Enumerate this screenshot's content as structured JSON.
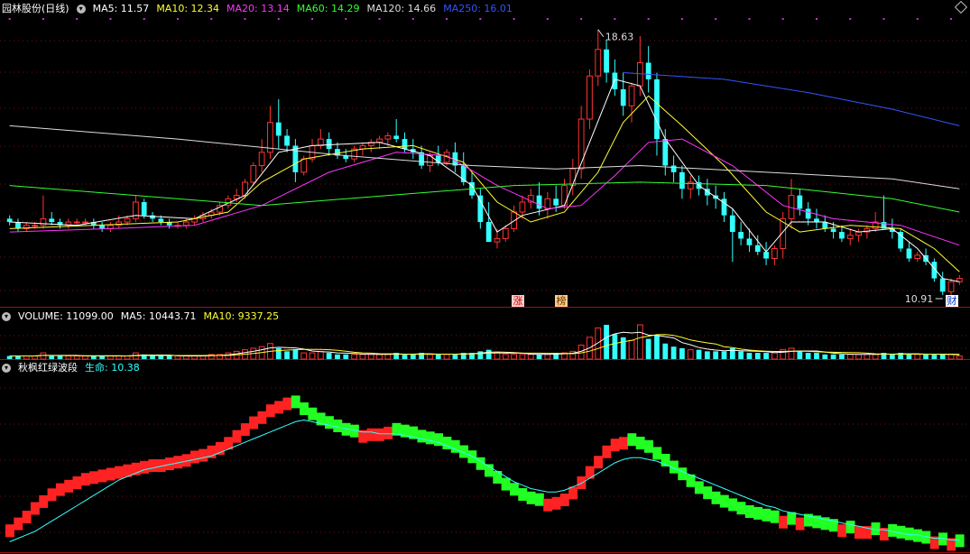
{
  "main_panel": {
    "stock_name": "园林股份(日线)",
    "ma_items": [
      {
        "label": "MA5: 11.57",
        "color": "#ffffff"
      },
      {
        "label": "MA10: 12.34",
        "color": "#ffff33"
      },
      {
        "label": "MA20: 13.14",
        "color": "#ff33ff"
      },
      {
        "label": "MA60: 14.29",
        "color": "#33ff33"
      },
      {
        "label": "MA120: 14.66",
        "color": "#dddddd"
      },
      {
        "label": "MA250: 16.01",
        "color": "#3355ff"
      }
    ],
    "high_label": "18.63",
    "low_label": "10.91",
    "tag_limit": "涨",
    "tag_rank": "榜",
    "tag_finance": "财"
  },
  "volume_panel": {
    "items": [
      {
        "label": "VOLUME: 11099.00",
        "color": "#ffffff"
      },
      {
        "label": "MA5: 10443.71",
        "color": "#ffffff"
      },
      {
        "label": "MA10: 9337.25",
        "color": "#ffff33"
      }
    ]
  },
  "indicator_panel": {
    "name": "秋枫红绿波段",
    "life_label": "生命: 10.38",
    "name_color": "#ffffff",
    "life_color": "#33ffff"
  },
  "chart_data": {
    "type": "candlestick",
    "price_range": [
      10.6,
      19.3
    ],
    "up_color": "#ff3333",
    "down_color": "#33ffff",
    "candles": [
      [
        13.2,
        13.3,
        13.0,
        13.1
      ],
      [
        13.1,
        13.2,
        12.8,
        12.9
      ],
      [
        12.9,
        13.1,
        12.8,
        13.0
      ],
      [
        13.0,
        13.1,
        12.9,
        13.0
      ],
      [
        13.0,
        13.9,
        12.9,
        13.2
      ],
      [
        13.2,
        13.4,
        13.0,
        13.1
      ],
      [
        13.1,
        13.2,
        12.9,
        13.0
      ],
      [
        13.0,
        13.2,
        12.9,
        13.1
      ],
      [
        13.1,
        13.2,
        13.0,
        13.1
      ],
      [
        13.1,
        13.2,
        13.0,
        13.1
      ],
      [
        13.1,
        13.2,
        12.9,
        13.0
      ],
      [
        13.0,
        13.1,
        12.8,
        12.9
      ],
      [
        12.9,
        13.1,
        12.8,
        13.0
      ],
      [
        13.0,
        13.3,
        12.9,
        13.1
      ],
      [
        13.1,
        13.3,
        13.0,
        13.2
      ],
      [
        13.2,
        13.9,
        13.1,
        13.7
      ],
      [
        13.7,
        13.8,
        13.2,
        13.3
      ],
      [
        13.3,
        13.4,
        13.1,
        13.2
      ],
      [
        13.2,
        13.3,
        13.0,
        13.1
      ],
      [
        13.1,
        13.2,
        12.9,
        13.0
      ],
      [
        13.0,
        13.1,
        12.9,
        13.0
      ],
      [
        13.0,
        13.2,
        12.9,
        13.1
      ],
      [
        13.1,
        13.3,
        13.0,
        13.2
      ],
      [
        13.2,
        13.4,
        13.1,
        13.3
      ],
      [
        13.3,
        13.5,
        13.2,
        13.4
      ],
      [
        13.4,
        13.7,
        13.3,
        13.6
      ],
      [
        13.6,
        13.9,
        13.5,
        13.8
      ],
      [
        13.8,
        14.1,
        13.7,
        13.9
      ],
      [
        13.9,
        14.4,
        13.8,
        14.3
      ],
      [
        14.3,
        14.9,
        14.2,
        14.8
      ],
      [
        14.8,
        15.6,
        14.6,
        15.2
      ],
      [
        15.2,
        16.6,
        15.0,
        16.1
      ],
      [
        16.1,
        16.8,
        15.3,
        15.7
      ],
      [
        15.7,
        15.9,
        15.2,
        15.4
      ],
      [
        15.4,
        15.6,
        14.3,
        14.6
      ],
      [
        14.6,
        15.1,
        14.5,
        15.0
      ],
      [
        15.0,
        15.6,
        14.9,
        15.4
      ],
      [
        15.4,
        15.9,
        15.3,
        15.6
      ],
      [
        15.6,
        15.8,
        15.1,
        15.3
      ],
      [
        15.3,
        15.5,
        15.0,
        15.1
      ],
      [
        15.1,
        15.3,
        14.9,
        15.0
      ],
      [
        15.0,
        15.4,
        14.9,
        15.3
      ],
      [
        15.3,
        15.5,
        15.1,
        15.4
      ],
      [
        15.4,
        15.6,
        15.2,
        15.5
      ],
      [
        15.5,
        15.7,
        15.3,
        15.6
      ],
      [
        15.6,
        15.8,
        15.4,
        15.7
      ],
      [
        15.7,
        16.2,
        15.5,
        15.6
      ],
      [
        15.6,
        15.8,
        15.2,
        15.3
      ],
      [
        15.3,
        15.6,
        15.0,
        15.2
      ],
      [
        15.2,
        15.4,
        14.7,
        14.8
      ],
      [
        14.8,
        15.2,
        14.6,
        15.1
      ],
      [
        15.1,
        15.4,
        14.8,
        14.9
      ],
      [
        14.9,
        15.3,
        14.8,
        15.2
      ],
      [
        15.2,
        15.5,
        14.6,
        14.8
      ],
      [
        14.8,
        15.2,
        14.2,
        14.3
      ],
      [
        14.3,
        14.6,
        13.8,
        13.9
      ],
      [
        13.9,
        14.1,
        12.9,
        13.1
      ],
      [
        13.1,
        13.7,
        12.7,
        12.5
      ],
      [
        12.5,
        12.9,
        12.3,
        12.6
      ],
      [
        12.6,
        13.0,
        12.5,
        12.9
      ],
      [
        12.9,
        13.6,
        12.8,
        13.4
      ],
      [
        13.4,
        13.9,
        13.2,
        13.7
      ],
      [
        13.7,
        14.1,
        13.5,
        13.9
      ],
      [
        13.9,
        14.3,
        13.3,
        13.5
      ],
      [
        13.5,
        14.0,
        13.2,
        13.8
      ],
      [
        13.8,
        14.2,
        13.4,
        13.6
      ],
      [
        13.6,
        14.4,
        13.5,
        14.2
      ],
      [
        14.2,
        15.0,
        13.9,
        14.7
      ],
      [
        14.7,
        16.6,
        14.4,
        16.2
      ],
      [
        16.2,
        17.7,
        15.9,
        17.5
      ],
      [
        17.5,
        18.9,
        17.2,
        18.3
      ],
      [
        18.3,
        18.6,
        17.3,
        17.6
      ],
      [
        17.6,
        18.0,
        16.9,
        17.1
      ],
      [
        17.1,
        17.6,
        16.3,
        16.6
      ],
      [
        16.6,
        17.3,
        16.1,
        17.2
      ],
      [
        17.2,
        18.7,
        16.9,
        17.9
      ],
      [
        17.9,
        18.4,
        17.0,
        17.4
      ],
      [
        17.4,
        17.6,
        15.1,
        15.6
      ],
      [
        15.6,
        15.9,
        14.5,
        14.8
      ],
      [
        14.8,
        15.1,
        14.3,
        14.6
      ],
      [
        14.6,
        14.8,
        13.8,
        14.1
      ],
      [
        14.1,
        14.5,
        13.8,
        14.3
      ],
      [
        14.3,
        14.5,
        13.9,
        14.1
      ],
      [
        14.1,
        14.4,
        13.6,
        13.9
      ],
      [
        13.9,
        14.2,
        13.5,
        13.8
      ],
      [
        13.8,
        14.0,
        13.1,
        13.3
      ],
      [
        13.3,
        13.5,
        11.9,
        12.8
      ],
      [
        12.8,
        13.1,
        12.4,
        12.6
      ],
      [
        12.6,
        12.9,
        12.2,
        12.4
      ],
      [
        12.4,
        12.7,
        12.1,
        12.2
      ],
      [
        12.2,
        12.5,
        11.8,
        12.0
      ],
      [
        12.0,
        12.4,
        11.8,
        12.3
      ],
      [
        12.3,
        13.4,
        12.0,
        13.2
      ],
      [
        13.2,
        14.4,
        12.9,
        13.9
      ],
      [
        13.9,
        14.1,
        13.3,
        13.5
      ],
      [
        13.5,
        13.7,
        13.0,
        13.2
      ],
      [
        13.2,
        13.5,
        12.9,
        13.1
      ],
      [
        13.1,
        13.3,
        12.8,
        12.9
      ],
      [
        12.9,
        13.1,
        12.6,
        12.8
      ],
      [
        12.8,
        13.0,
        12.5,
        12.6
      ],
      [
        12.6,
        12.9,
        12.4,
        12.7
      ],
      [
        12.7,
        12.9,
        12.5,
        12.8
      ],
      [
        12.8,
        13.0,
        12.6,
        12.9
      ],
      [
        12.9,
        13.4,
        12.8,
        13.1
      ],
      [
        13.1,
        13.9,
        13.0,
        12.9
      ],
      [
        12.9,
        13.2,
        12.6,
        12.8
      ],
      [
        12.8,
        12.9,
        12.2,
        12.3
      ],
      [
        12.3,
        12.5,
        11.9,
        12.0
      ],
      [
        12.0,
        12.2,
        11.9,
        12.1
      ],
      [
        12.1,
        12.3,
        11.8,
        11.9
      ],
      [
        11.9,
        12.0,
        11.3,
        11.4
      ],
      [
        11.4,
        11.6,
        10.9,
        11.0
      ],
      [
        11.0,
        11.4,
        10.9,
        11.3
      ],
      [
        11.3,
        11.5,
        11.2,
        11.4
      ]
    ],
    "ma_series": [
      {
        "name": "MA5",
        "color": "#ffffff",
        "points": [
          [
            0,
            13.1
          ],
          [
            8,
            13.0
          ],
          [
            15,
            13.3
          ],
          [
            22,
            13.2
          ],
          [
            28,
            13.9
          ],
          [
            32,
            15.2
          ],
          [
            36,
            15.4
          ],
          [
            44,
            15.5
          ],
          [
            50,
            15.1
          ],
          [
            55,
            14.2
          ],
          [
            58,
            12.8
          ],
          [
            61,
            13.3
          ],
          [
            66,
            13.6
          ],
          [
            69,
            15.5
          ],
          [
            72,
            17.4
          ],
          [
            75,
            17.2
          ],
          [
            78,
            15.6
          ],
          [
            82,
            14.2
          ],
          [
            86,
            13.5
          ],
          [
            90,
            12.2
          ],
          [
            93,
            13.1
          ],
          [
            97,
            13.1
          ],
          [
            101,
            12.8
          ],
          [
            105,
            12.9
          ],
          [
            108,
            12.3
          ],
          [
            111,
            11.4
          ],
          [
            113,
            11.3
          ]
        ]
      },
      {
        "name": "MA10",
        "color": "#ffff33",
        "points": [
          [
            0,
            12.9
          ],
          [
            10,
            13.0
          ],
          [
            20,
            13.1
          ],
          [
            26,
            13.4
          ],
          [
            30,
            14.3
          ],
          [
            35,
            15.0
          ],
          [
            42,
            15.3
          ],
          [
            48,
            15.4
          ],
          [
            54,
            14.9
          ],
          [
            58,
            13.7
          ],
          [
            62,
            13.1
          ],
          [
            66,
            13.4
          ],
          [
            70,
            14.6
          ],
          [
            73,
            16.1
          ],
          [
            76,
            16.9
          ],
          [
            80,
            16.0
          ],
          [
            85,
            14.8
          ],
          [
            90,
            13.4
          ],
          [
            94,
            12.8
          ],
          [
            100,
            13.0
          ],
          [
            106,
            12.9
          ],
          [
            110,
            12.3
          ],
          [
            113,
            11.6
          ]
        ]
      },
      {
        "name": "MA20",
        "color": "#ff33ff",
        "points": [
          [
            0,
            12.8
          ],
          [
            12,
            12.9
          ],
          [
            22,
            13.0
          ],
          [
            30,
            13.6
          ],
          [
            38,
            14.6
          ],
          [
            46,
            15.2
          ],
          [
            52,
            15.1
          ],
          [
            58,
            14.2
          ],
          [
            64,
            13.5
          ],
          [
            68,
            13.6
          ],
          [
            72,
            14.5
          ],
          [
            76,
            15.5
          ],
          [
            80,
            15.6
          ],
          [
            86,
            14.8
          ],
          [
            92,
            13.6
          ],
          [
            98,
            13.2
          ],
          [
            106,
            13.0
          ],
          [
            113,
            12.4
          ]
        ]
      },
      {
        "name": "MA60",
        "color": "#33ff33",
        "points": [
          [
            0,
            14.2
          ],
          [
            15,
            13.9
          ],
          [
            30,
            13.6
          ],
          [
            45,
            13.9
          ],
          [
            60,
            14.2
          ],
          [
            75,
            14.3
          ],
          [
            90,
            14.2
          ],
          [
            105,
            13.8
          ],
          [
            113,
            13.4
          ]
        ]
      },
      {
        "name": "MA120",
        "color": "#dddddd",
        "points": [
          [
            0,
            16.0
          ],
          [
            20,
            15.6
          ],
          [
            40,
            15.1
          ],
          [
            55,
            14.8
          ],
          [
            65,
            14.7
          ],
          [
            75,
            14.8
          ],
          [
            90,
            14.6
          ],
          [
            105,
            14.4
          ],
          [
            113,
            14.1
          ]
        ]
      },
      {
        "name": "MA250",
        "color": "#3355ff",
        "points": [
          [
            73,
            17.6
          ],
          [
            85,
            17.4
          ],
          [
            95,
            17.0
          ],
          [
            105,
            16.5
          ],
          [
            113,
            16.0
          ]
        ]
      }
    ],
    "volume": [
      2,
      2,
      2,
      2,
      4,
      2,
      2,
      2,
      2,
      2,
      2,
      2,
      2,
      2,
      2,
      4,
      3,
      2,
      2,
      2,
      2,
      2,
      2,
      2,
      3,
      3,
      4,
      5,
      6,
      7,
      8,
      10,
      7,
      5,
      6,
      4,
      4,
      5,
      4,
      3,
      3,
      3,
      3,
      3,
      3,
      3,
      4,
      3,
      3,
      4,
      3,
      3,
      3,
      3,
      4,
      4,
      5,
      6,
      4,
      3,
      3,
      3,
      3,
      3,
      3,
      4,
      4,
      5,
      9,
      14,
      20,
      22,
      16,
      14,
      12,
      22,
      13,
      15,
      10,
      8,
      7,
      6,
      6,
      5,
      5,
      5,
      7,
      5,
      4,
      4,
      4,
      4,
      6,
      7,
      5,
      4,
      4,
      3,
      3,
      3,
      3,
      3,
      3,
      3,
      4,
      3,
      4,
      3,
      3,
      3,
      3,
      3,
      3,
      2
    ],
    "indicator": {
      "range": [
        0,
        100
      ],
      "wave": [
        12,
        16,
        20,
        25,
        29,
        33,
        36,
        38,
        40,
        42,
        43,
        44,
        45,
        46,
        47,
        48,
        49,
        50,
        50,
        51,
        52,
        53,
        55,
        56,
        58,
        60,
        63,
        67,
        71,
        75,
        78,
        82,
        84,
        86,
        84,
        80,
        77,
        74,
        72,
        70,
        68,
        67,
        67,
        68,
        68,
        69,
        68,
        67,
        66,
        64,
        63,
        62,
        60,
        58,
        55,
        52,
        48,
        44,
        40,
        36,
        33,
        30,
        28,
        27,
        27,
        28,
        30,
        34,
        40,
        46,
        52,
        58,
        62,
        63,
        62,
        60,
        58,
        54,
        50,
        46,
        42,
        38,
        34,
        31,
        28,
        26,
        24,
        22,
        20,
        19,
        18,
        17,
        17,
        16,
        16,
        15,
        14,
        13,
        12,
        12,
        11,
        11,
        11,
        10,
        10,
        9,
        8,
        7,
        6,
        5,
        5,
        4,
        4,
        3
      ],
      "life_line": [
        4,
        6,
        8,
        10,
        13,
        16,
        19,
        22,
        25,
        28,
        31,
        34,
        37,
        40,
        42,
        44,
        46,
        47,
        48,
        49,
        50,
        51,
        52,
        53,
        54,
        56,
        58,
        60,
        62,
        64,
        66,
        68,
        70,
        72,
        74,
        75,
        74,
        73,
        72,
        71,
        70,
        69,
        68,
        68,
        67,
        67,
        67,
        66,
        65,
        64,
        63,
        62,
        60,
        58,
        56,
        54,
        51,
        48,
        45,
        42,
        39,
        37,
        35,
        34,
        33,
        33,
        34,
        36,
        38,
        41,
        44,
        47,
        50,
        52,
        53,
        53,
        52,
        51,
        49,
        47,
        45,
        43,
        41,
        39,
        37,
        35,
        33,
        31,
        29,
        27,
        25,
        24,
        22,
        21,
        20,
        19,
        18,
        17,
        16,
        15,
        14,
        13,
        12,
        11,
        11,
        10,
        9,
        8,
        8,
        7,
        6,
        6,
        5,
        5
      ],
      "colors": {
        "rising": "#ff2222",
        "falling": "#22ff22",
        "life": "#33ffff"
      }
    }
  }
}
